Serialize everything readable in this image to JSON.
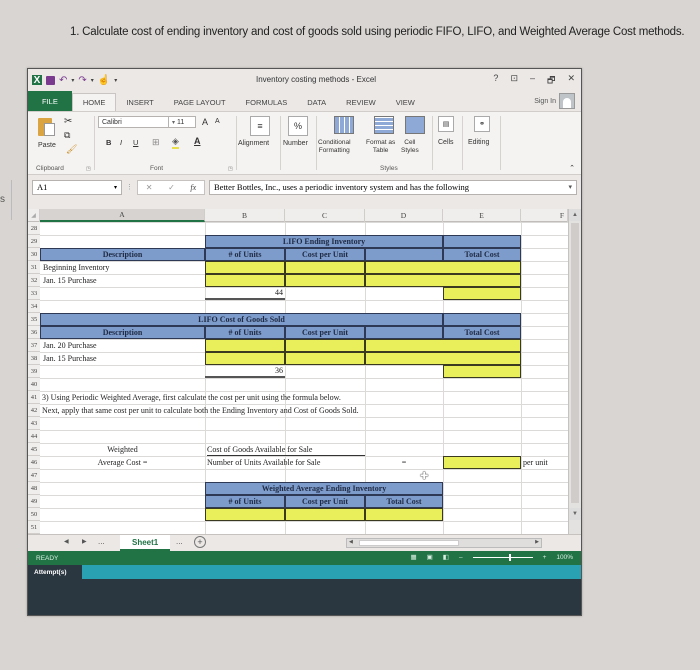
{
  "question": "1. Calculate cost of ending inventory and cost of goods sold using periodic FIFO, LIFO, and Weighted Average Cost methods.",
  "left_fragment": "s",
  "window": {
    "title": "Inventory costing methods - Excel",
    "controls": {
      "help": "?",
      "restore_ribbon": "⊡",
      "minimize": "–",
      "maximize": "🗗",
      "close": "✕"
    },
    "sign_in": "Sign In"
  },
  "tabs": [
    "FILE",
    "HOME",
    "INSERT",
    "PAGE LAYOUT",
    "FORMULAS",
    "DATA",
    "REVIEW",
    "VIEW"
  ],
  "ribbon": {
    "clipboard": {
      "paste": "Paste",
      "label": "Clipboard"
    },
    "font": {
      "name": "Calibri",
      "size": "11",
      "grow": "A",
      "shrink": "A",
      "bold": "B",
      "italic": "I",
      "underline": "U",
      "label": "Font"
    },
    "alignment": "Alignment",
    "number": "Number",
    "number_icon": "%",
    "styles": {
      "conditional": "Conditional",
      "conditional2": "Formatting",
      "format_table": "Format as",
      "format_table2": "Table",
      "cell_styles": "Cell",
      "cell_styles2": "Styles",
      "label": "Styles"
    },
    "cells": "Cells",
    "editing": "Editing"
  },
  "formula_bar": {
    "name_box": "A1",
    "cancel": "✕",
    "enter": "✓",
    "fx": "fx",
    "content": "Better Bottles, Inc., uses a periodic inventory system and has the following"
  },
  "columns": [
    "A",
    "B",
    "C",
    "D",
    "E",
    "F"
  ],
  "rows": [
    "28",
    "29",
    "30",
    "31",
    "32",
    "33",
    "34",
    "35",
    "36",
    "37",
    "38",
    "39",
    "40",
    "41",
    "42",
    "43",
    "44",
    "45",
    "46",
    "47",
    "48",
    "49",
    "50",
    "51"
  ],
  "lifo_ending": {
    "title": "LIFO Ending Inventory",
    "headers": [
      "Description",
      "# of Units",
      "Cost per Unit",
      "Total Cost"
    ],
    "rows": [
      "Beginning Inventory",
      "Jan. 15 Purchase"
    ],
    "total_units": "44"
  },
  "lifo_cogs": {
    "title": "LIFO Cost of Goods Sold",
    "headers": [
      "Description",
      "# of Units",
      "Cost per Unit",
      "Total Cost"
    ],
    "rows": [
      "Jan. 20 Purchase",
      "Jan. 15 Purchase"
    ],
    "total_units": "36"
  },
  "instructions": {
    "line1": "3) Using Periodic Weighted Average, first calculate the cost per unit using the formula below.",
    "line2": "Next, apply that same cost per unit to calculate both the Ending Inventory and Cost of Goods Sold."
  },
  "weighted_formula": {
    "label1": "Weighted",
    "label2": "Average Cost  =",
    "numerator": "Cost of Goods Available for Sale",
    "denominator": "Number of Units Available for Sale",
    "equals": "=",
    "suffix": "per unit"
  },
  "wa_ending": {
    "title": "Weighted Average Ending Inventory",
    "headers": [
      "# of Units",
      "Cost per Unit",
      "Total Cost"
    ]
  },
  "sheet_bar": {
    "sheet": "Sheet1",
    "more": "...",
    "add": "+"
  },
  "status": {
    "text": "READY",
    "zoom": "100%"
  },
  "attempts_label": "Attempt(s)",
  "colors": {
    "excel_green": "#217346",
    "header_blue": "#7d9ccb",
    "input_yellow": "#e8ef5a",
    "teal": "#2aa1b3"
  }
}
